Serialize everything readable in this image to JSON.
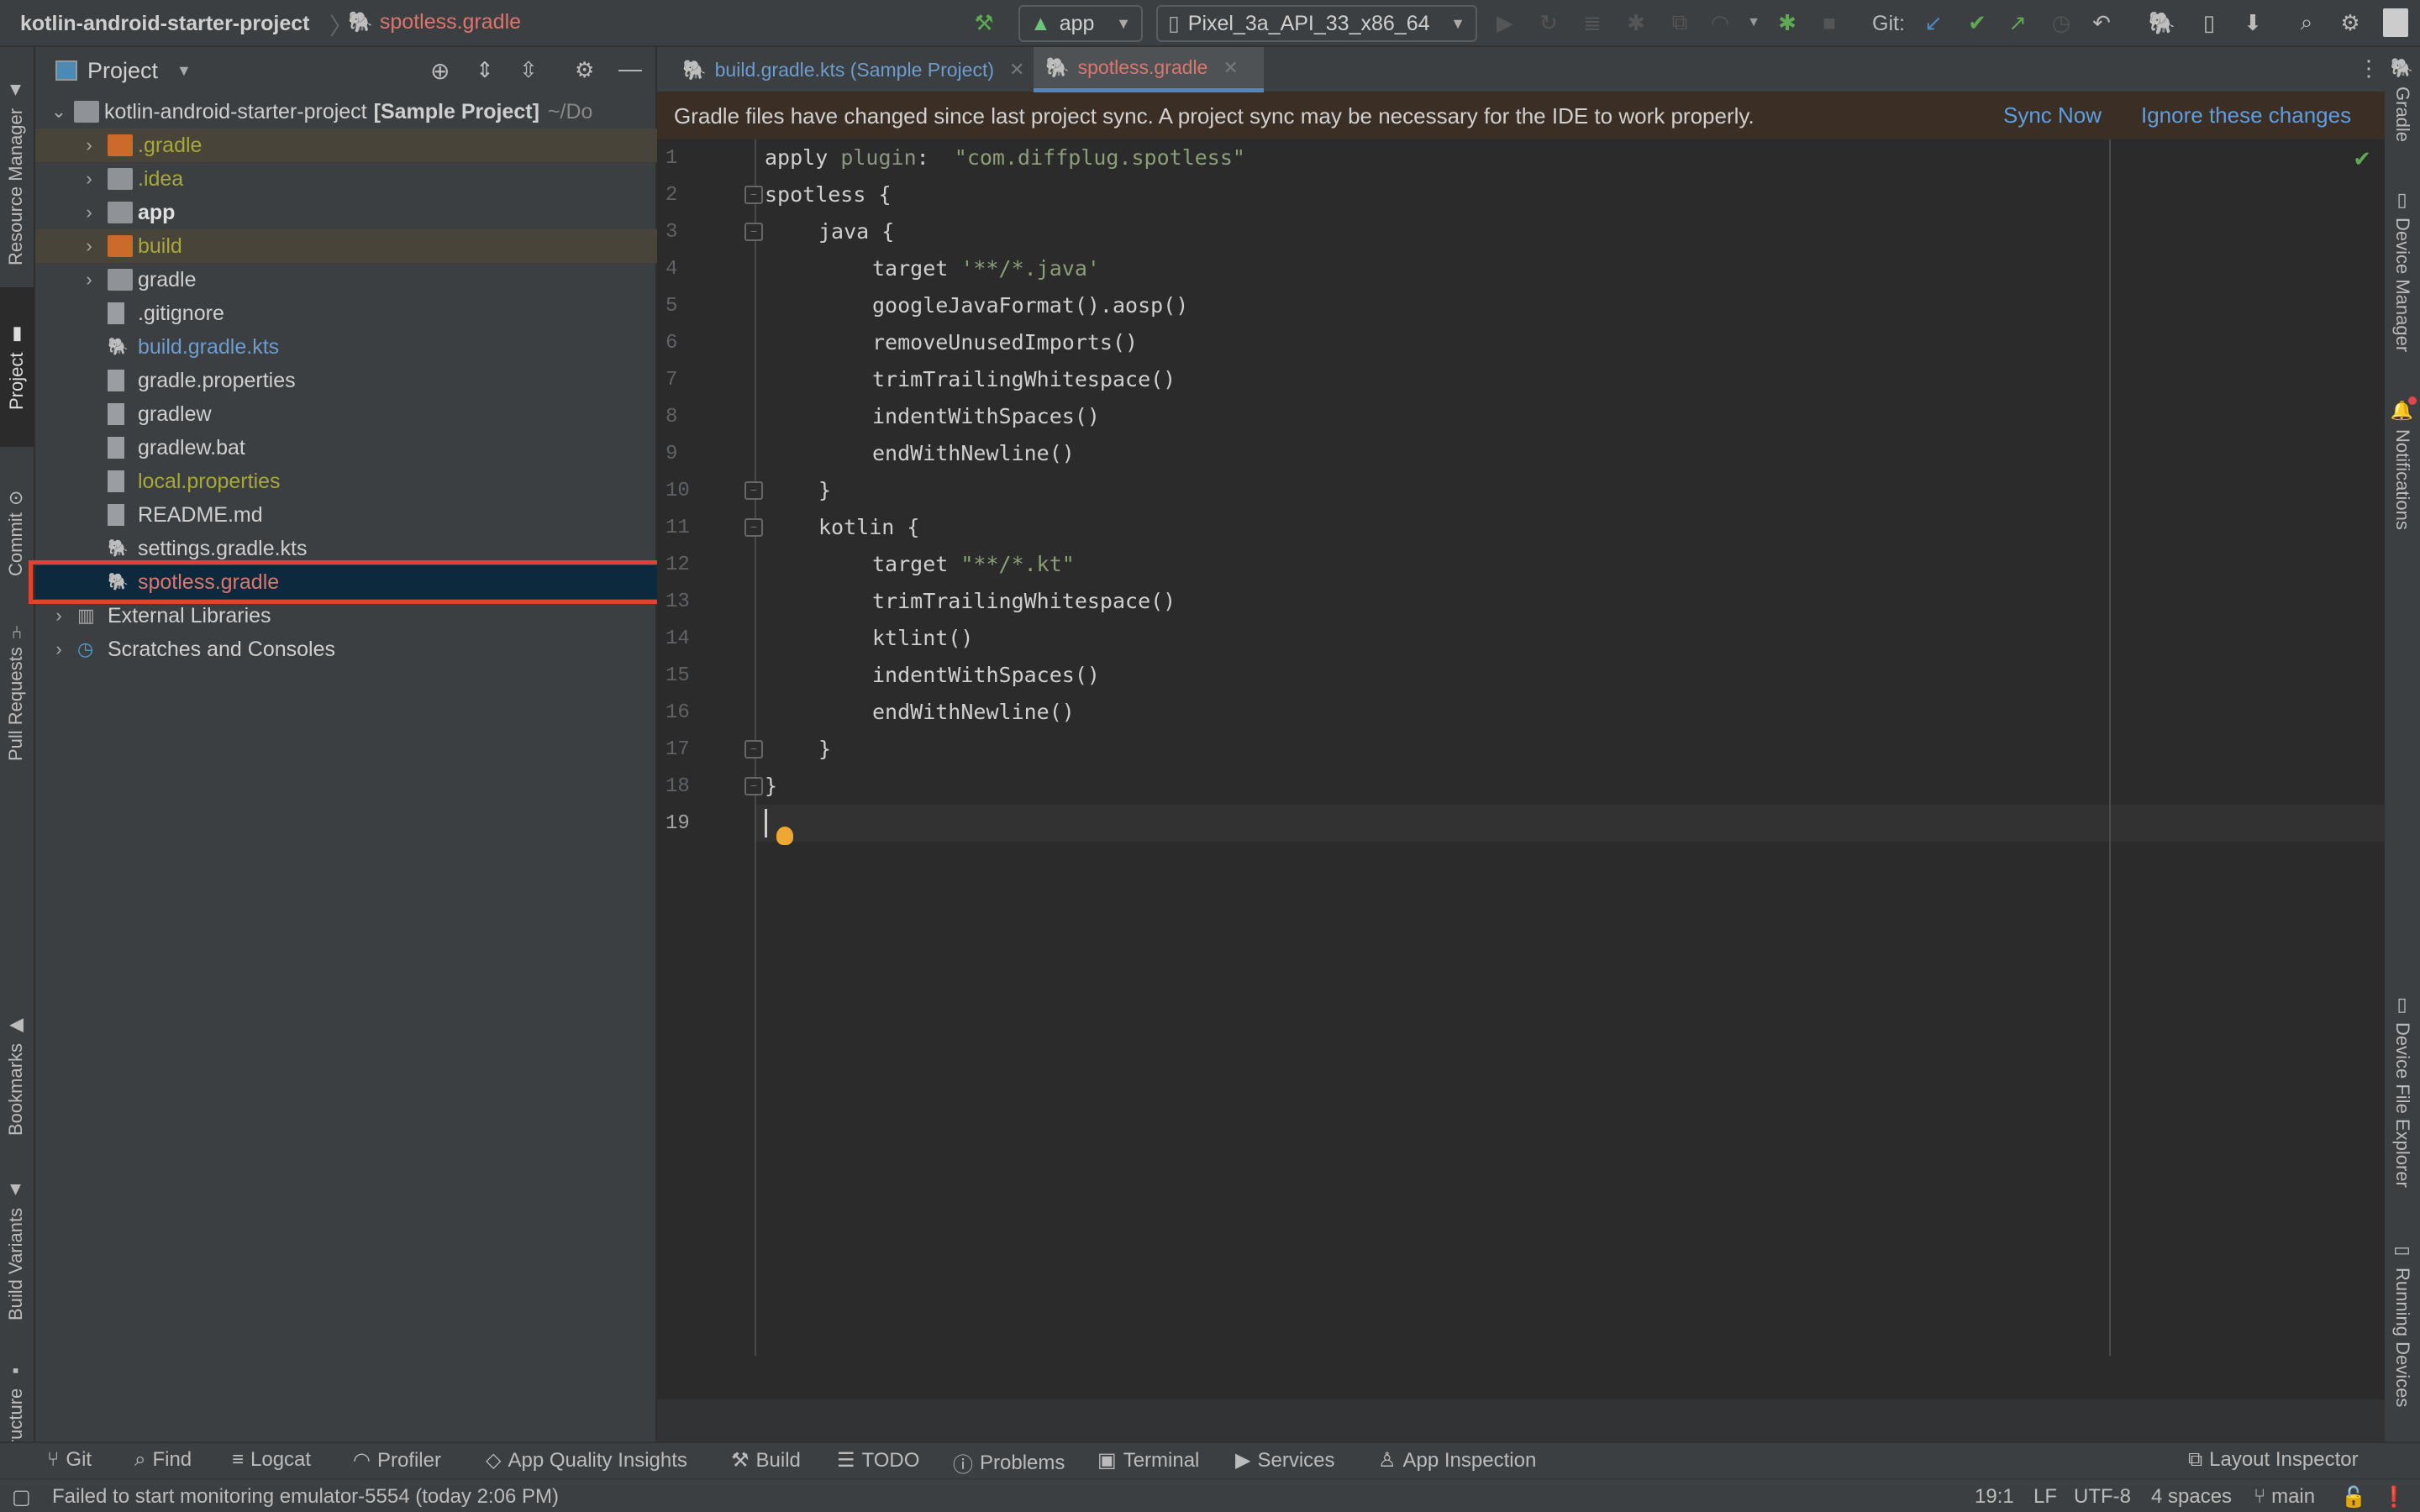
{
  "titlebar": {
    "project": "kotlin-android-starter-project",
    "file": "spotless.gradle",
    "run_config": "app",
    "device": "Pixel_3a_API_33_x86_64",
    "git_label": "Git:"
  },
  "left_strip": {
    "tabs": [
      "Resource Manager",
      "Project",
      "Commit",
      "Pull Requests",
      "Bookmarks",
      "Build Variants",
      "Structure"
    ]
  },
  "right_strip": {
    "tabs": [
      "Gradle",
      "Device Manager",
      "Notifications",
      "Device File Explorer",
      "Running Devices"
    ]
  },
  "project_panel": {
    "title": "Project",
    "root": {
      "name": "kotlin-android-starter-project",
      "tag": "[Sample Project]",
      "path": "~/Do"
    },
    "items": [
      {
        "name": ".gradle",
        "type": "folder-excluded",
        "color": "#a8a83a",
        "expandable": true
      },
      {
        "name": ".idea",
        "type": "folder",
        "color": "#a8a83a",
        "expandable": true
      },
      {
        "name": "app",
        "type": "module",
        "color": "#e0e0e0",
        "expandable": true
      },
      {
        "name": "build",
        "type": "folder-excluded",
        "color": "#a8a83a",
        "expandable": true
      },
      {
        "name": "gradle",
        "type": "folder",
        "color": "#cfcfcf",
        "expandable": true
      },
      {
        "name": ".gitignore",
        "type": "file",
        "color": "#cfcfcf"
      },
      {
        "name": "build.gradle.kts",
        "type": "gradle-kts",
        "color": "#6d9ccf"
      },
      {
        "name": "gradle.properties",
        "type": "properties",
        "color": "#cfcfcf"
      },
      {
        "name": "gradlew",
        "type": "script",
        "color": "#cfcfcf"
      },
      {
        "name": "gradlew.bat",
        "type": "file",
        "color": "#cfcfcf"
      },
      {
        "name": "local.properties",
        "type": "properties",
        "color": "#a8a83a"
      },
      {
        "name": "README.md",
        "type": "markdown",
        "color": "#cfcfcf"
      },
      {
        "name": "settings.gradle.kts",
        "type": "gradle-kts",
        "color": "#cfcfcf"
      },
      {
        "name": "spotless.gradle",
        "type": "gradle",
        "color": "#d9776e",
        "selected": true
      }
    ],
    "extra": [
      {
        "name": "External Libraries"
      },
      {
        "name": "Scratches and Consoles"
      }
    ]
  },
  "editor": {
    "tabs": [
      {
        "label": "build.gradle.kts (Sample Project)",
        "color": "#6d9ccf",
        "active": false
      },
      {
        "label": "spotless.gradle",
        "color": "#d9776e",
        "active": true
      }
    ],
    "banner": {
      "message": "Gradle files have changed since last project sync. A project sync may be necessary for the IDE to work properly.",
      "sync_now": "Sync Now",
      "ignore": "Ignore these changes"
    },
    "lines": [
      {
        "n": "1",
        "indent": 0,
        "parts": [
          [
            "apply ",
            ""
          ],
          [
            "plugin",
            "kw-gray"
          ],
          [
            ":  ",
            ""
          ],
          [
            "\"com.diffplug.spotless\"",
            "str"
          ]
        ]
      },
      {
        "n": "2",
        "indent": 0,
        "parts": [
          [
            "spotless {",
            ""
          ]
        ]
      },
      {
        "n": "3",
        "indent": 1,
        "parts": [
          [
            "java {",
            ""
          ]
        ]
      },
      {
        "n": "4",
        "indent": 2,
        "parts": [
          [
            "target ",
            ""
          ],
          [
            "'**/*.java'",
            "str"
          ]
        ]
      },
      {
        "n": "5",
        "indent": 2,
        "parts": [
          [
            "googleJavaFormat().aosp()",
            ""
          ]
        ]
      },
      {
        "n": "6",
        "indent": 2,
        "parts": [
          [
            "removeUnusedImports()",
            ""
          ]
        ]
      },
      {
        "n": "7",
        "indent": 2,
        "parts": [
          [
            "trimTrailingWhitespace()",
            ""
          ]
        ]
      },
      {
        "n": "8",
        "indent": 2,
        "parts": [
          [
            "indentWithSpaces()",
            ""
          ]
        ]
      },
      {
        "n": "9",
        "indent": 2,
        "parts": [
          [
            "endWithNewline()",
            ""
          ]
        ]
      },
      {
        "n": "10",
        "indent": 1,
        "parts": [
          [
            "}",
            ""
          ]
        ]
      },
      {
        "n": "11",
        "indent": 1,
        "parts": [
          [
            "kotlin {",
            ""
          ]
        ]
      },
      {
        "n": "12",
        "indent": 2,
        "parts": [
          [
            "target ",
            ""
          ],
          [
            "\"**/*.kt\"",
            "str"
          ]
        ]
      },
      {
        "n": "13",
        "indent": 2,
        "parts": [
          [
            "trimTrailingWhitespace()",
            ""
          ]
        ]
      },
      {
        "n": "14",
        "indent": 2,
        "parts": [
          [
            "ktlint()",
            ""
          ]
        ]
      },
      {
        "n": "15",
        "indent": 2,
        "parts": [
          [
            "indentWithSpaces()",
            ""
          ]
        ]
      },
      {
        "n": "16",
        "indent": 2,
        "parts": [
          [
            "endWithNewline()",
            ""
          ]
        ]
      },
      {
        "n": "17",
        "indent": 1,
        "parts": [
          [
            "}",
            ""
          ]
        ]
      },
      {
        "n": "18",
        "indent": 0,
        "parts": [
          [
            "}",
            ""
          ]
        ]
      },
      {
        "n": "19",
        "indent": 0,
        "parts": [
          [
            "",
            ""
          ]
        ]
      }
    ],
    "fold_lines": [
      2,
      3,
      10,
      11,
      17,
      18
    ],
    "caret_line": 19
  },
  "bottom_toolbar": {
    "items": [
      {
        "label": "Git",
        "icon": "git-branch-icon",
        "glyph": "⑂"
      },
      {
        "label": "Find",
        "icon": "search-icon",
        "glyph": "⌕"
      },
      {
        "label": "Logcat",
        "icon": "logcat-icon",
        "glyph": "≡"
      },
      {
        "label": "Profiler",
        "icon": "profiler-icon",
        "glyph": "◠"
      },
      {
        "label": "App Quality Insights",
        "icon": "diamond-icon",
        "glyph": "◇"
      },
      {
        "label": "Build",
        "icon": "hammer-icon",
        "glyph": "⚒"
      },
      {
        "label": "TODO",
        "icon": "list-icon",
        "glyph": "☰"
      },
      {
        "label": "Problems",
        "icon": "warning-icon",
        "glyph": "ⓘ"
      },
      {
        "label": "Terminal",
        "icon": "terminal-icon",
        "glyph": "▣"
      },
      {
        "label": "Services",
        "icon": "services-icon",
        "glyph": "▶"
      },
      {
        "label": "App Inspection",
        "icon": "app-inspection-icon",
        "glyph": "♙"
      }
    ],
    "right": {
      "label": "Layout Inspector",
      "icon": "layout-inspector-icon"
    }
  },
  "status_bar": {
    "message": "Failed to start monitoring emulator-5554 (today 2:06 PM)",
    "position": "19:1",
    "line_sep": "LF",
    "encoding": "UTF-8",
    "indent": "4 spaces",
    "branch": "main"
  }
}
